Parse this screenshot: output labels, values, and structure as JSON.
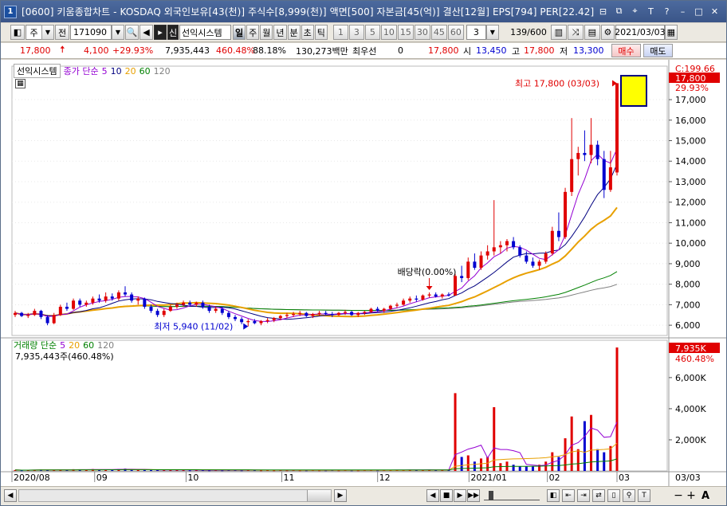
{
  "window": {
    "title": "[0600] 키움종합차트 - KOSDAQ 외국인보유[43(천)] 주식수[8,999(천)] 액면[500] 자본금[45(억)] 결산[12월] EPS[794] PER[22.42]",
    "icon_label": "1"
  },
  "toolbar": {
    "period_label": "주",
    "prev_label": "전",
    "code": "171090",
    "strategy_label": "선익시스템",
    "intervals": [
      "일",
      "주",
      "월",
      "년",
      "분",
      "초",
      "틱"
    ],
    "selected_interval": "일",
    "minute_values": [
      "1",
      "3",
      "5",
      "10",
      "15",
      "30",
      "45",
      "60"
    ],
    "interval_input": "3",
    "page": "139/600",
    "date": "2021/03/03"
  },
  "quote": {
    "price": "17,800",
    "change": "4,100",
    "change_pct": "+29.93%",
    "volume": "7,935,443",
    "vol_pct": "460.48%",
    "rate": "88.18%",
    "amount": "130,273백만",
    "pref_label": "최우선",
    "pref_value": "0",
    "pref_price": "17,800",
    "open_label": "시",
    "open": "13,450",
    "high_label": "고",
    "high": "17,800",
    "low_label": "저",
    "low": "13,300",
    "buy_label": "매수",
    "sell_label": "매도"
  },
  "price_legend": {
    "name": "선익시스템",
    "ma_label": "종가 단순",
    "periods": [
      "5",
      "10",
      "20",
      "60",
      "120"
    ]
  },
  "volume_legend": {
    "ma_label": "거래량 단순",
    "periods": [
      "5",
      "20",
      "60",
      "120"
    ],
    "current": "7,935,443주(460.48%)"
  },
  "annotations": {
    "high_note": "최고 17,800 (03/03)",
    "low_note": "최저 5,940 (11/02)",
    "dividend_note": "배당락(0.00%)"
  },
  "price_axis": {
    "labels": [
      "C:199.66",
      "17,800",
      "29.93%",
      "17,000",
      "16,000",
      "15,000",
      "14,000",
      "13,000",
      "12,000",
      "11,000",
      "10,000",
      "9,000",
      "8,000",
      "7,000",
      "6,000"
    ]
  },
  "volume_axis": {
    "labels": [
      "7,935K",
      "460.48%",
      "6,000K",
      "4,000K",
      "2,000K"
    ]
  },
  "date_axis": {
    "labels": [
      "2020/08",
      "09",
      "10",
      "11",
      "12",
      "2021/01",
      "02",
      "03",
      "03/03"
    ]
  },
  "colors": {
    "up": "#e00000",
    "down": "#0000d0",
    "ma5": "#9400d3",
    "ma10": "#000080",
    "ma20": "#e8a000",
    "ma60": "#008000",
    "ma120": "#808080",
    "accent": "#ffff00"
  },
  "chart_data": {
    "type": "candlestick",
    "y_range": [
      5500,
      18400
    ],
    "volume_range_k": [
      0,
      8400
    ],
    "candles": [
      [
        6500,
        6700,
        6400,
        6600
      ],
      [
        6600,
        6650,
        6400,
        6450
      ],
      [
        6450,
        6600,
        6350,
        6500
      ],
      [
        6500,
        6800,
        6450,
        6700
      ],
      [
        6700,
        6750,
        6300,
        6400
      ],
      [
        6400,
        6500,
        6000,
        6100
      ],
      [
        6100,
        6600,
        6050,
        6500
      ],
      [
        6500,
        7000,
        6450,
        6900
      ],
      [
        6900,
        7100,
        6700,
        6800
      ],
      [
        6800,
        7300,
        6750,
        7200
      ],
      [
        7200,
        7300,
        6900,
        7000
      ],
      [
        7000,
        7200,
        6900,
        7100
      ],
      [
        7100,
        7400,
        7000,
        7300
      ],
      [
        7300,
        7500,
        7100,
        7200
      ],
      [
        7200,
        7600,
        7100,
        7400
      ],
      [
        7400,
        7550,
        7200,
        7300
      ],
      [
        7300,
        7700,
        7200,
        7600
      ],
      [
        7600,
        7900,
        7400,
        7500
      ],
      [
        7500,
        7600,
        7100,
        7200
      ],
      [
        7200,
        7400,
        7000,
        7300
      ],
      [
        7300,
        7350,
        6800,
        6900
      ],
      [
        6900,
        7000,
        6600,
        6700
      ],
      [
        6700,
        6800,
        6400,
        6500
      ],
      [
        6500,
        6800,
        6400,
        6700
      ],
      [
        6700,
        7000,
        6650,
        6900
      ],
      [
        6900,
        7100,
        6800,
        7000
      ],
      [
        7000,
        7200,
        6900,
        7100
      ],
      [
        7100,
        7200,
        6900,
        7000
      ],
      [
        7000,
        7150,
        6900,
        7100
      ],
      [
        7100,
        7200,
        6800,
        6900
      ],
      [
        6900,
        7000,
        6600,
        6700
      ],
      [
        6700,
        6900,
        6600,
        6800
      ],
      [
        6800,
        6900,
        6500,
        6600
      ],
      [
        6600,
        6700,
        6300,
        6400
      ],
      [
        6400,
        6500,
        6200,
        6300
      ],
      [
        6300,
        6400,
        6050,
        6150
      ],
      [
        6150,
        6300,
        5940,
        6200
      ],
      [
        6200,
        6300,
        6050,
        6100
      ],
      [
        6100,
        6250,
        6000,
        6200
      ],
      [
        6200,
        6350,
        6100,
        6250
      ],
      [
        6250,
        6400,
        6150,
        6350
      ],
      [
        6350,
        6500,
        6250,
        6450
      ],
      [
        6450,
        6600,
        6350,
        6500
      ],
      [
        6500,
        6650,
        6400,
        6550
      ],
      [
        6550,
        6700,
        6450,
        6600
      ],
      [
        6600,
        6650,
        6400,
        6450
      ],
      [
        6450,
        6600,
        6350,
        6550
      ],
      [
        6550,
        6700,
        6450,
        6600
      ],
      [
        6600,
        6700,
        6500,
        6550
      ],
      [
        6550,
        6650,
        6400,
        6500
      ],
      [
        6500,
        6650,
        6450,
        6600
      ],
      [
        6600,
        6750,
        6500,
        6650
      ],
      [
        6650,
        6700,
        6450,
        6500
      ],
      [
        6500,
        6650,
        6400,
        6600
      ],
      [
        6600,
        6700,
        6500,
        6650
      ],
      [
        6650,
        6850,
        6600,
        6800
      ],
      [
        6800,
        6900,
        6650,
        6700
      ],
      [
        6700,
        6850,
        6600,
        6800
      ],
      [
        6800,
        7000,
        6750,
        6950
      ],
      [
        6950,
        7100,
        6850,
        7000
      ],
      [
        7000,
        7300,
        6950,
        7200
      ],
      [
        7200,
        7400,
        7100,
        7300
      ],
      [
        7300,
        7450,
        7150,
        7250
      ],
      [
        7250,
        7500,
        7200,
        7450
      ],
      [
        7450,
        7600,
        7350,
        7500
      ],
      [
        7500,
        7600,
        7350,
        7400
      ],
      [
        7400,
        7550,
        7300,
        7500
      ],
      [
        7500,
        7600,
        7400,
        7450
      ],
      [
        7450,
        8500,
        7450,
        8400
      ],
      [
        8400,
        8900,
        8100,
        8300
      ],
      [
        8300,
        9300,
        8200,
        9100
      ],
      [
        9100,
        9500,
        8700,
        8800
      ],
      [
        8800,
        9600,
        8700,
        9400
      ],
      [
        9400,
        9900,
        9200,
        9600
      ],
      [
        9600,
        12100,
        9400,
        9800
      ],
      [
        9800,
        10100,
        9500,
        9900
      ],
      [
        9900,
        10200,
        9600,
        10100
      ],
      [
        10100,
        10300,
        9700,
        9800
      ],
      [
        9800,
        9900,
        9300,
        9400
      ],
      [
        9400,
        9600,
        9000,
        9100
      ],
      [
        9100,
        9300,
        8800,
        8900
      ],
      [
        8900,
        9200,
        8700,
        9100
      ],
      [
        9100,
        9600,
        9000,
        9500
      ],
      [
        9500,
        10800,
        9400,
        10600
      ],
      [
        10600,
        11500,
        10100,
        10300
      ],
      [
        10300,
        12700,
        10200,
        12500
      ],
      [
        12500,
        16100,
        12300,
        14100
      ],
      [
        14100,
        14700,
        13300,
        14400
      ],
      [
        14400,
        15500,
        14000,
        14300
      ],
      [
        14300,
        16100,
        13900,
        14800
      ],
      [
        14800,
        15000,
        13800,
        14100
      ],
      [
        14100,
        14500,
        12200,
        12600
      ],
      [
        12600,
        14500,
        12500,
        13700
      ],
      [
        13450,
        17800,
        13300,
        17800
      ]
    ],
    "volumes_k": [
      60,
      40,
      50,
      70,
      90,
      60,
      50,
      80,
      70,
      110,
      90,
      60,
      120,
      80,
      100,
      70,
      130,
      150,
      90,
      70,
      60,
      50,
      60,
      70,
      80,
      60,
      50,
      40,
      60,
      50,
      40,
      50,
      40,
      60,
      50,
      40,
      70,
      50,
      40,
      50,
      40,
      50,
      40,
      50,
      40,
      40,
      50,
      40,
      40,
      50,
      40,
      50,
      40,
      40,
      50,
      60,
      40,
      50,
      60,
      60,
      70,
      80,
      60,
      70,
      80,
      50,
      60,
      50,
      5000,
      900,
      1000,
      600,
      800,
      900,
      4100,
      500,
      600,
      400,
      300,
      300,
      300,
      400,
      600,
      1200,
      900,
      2100,
      3500,
      1400,
      3200,
      3600,
      1400,
      1200,
      1600,
      7935
    ]
  }
}
